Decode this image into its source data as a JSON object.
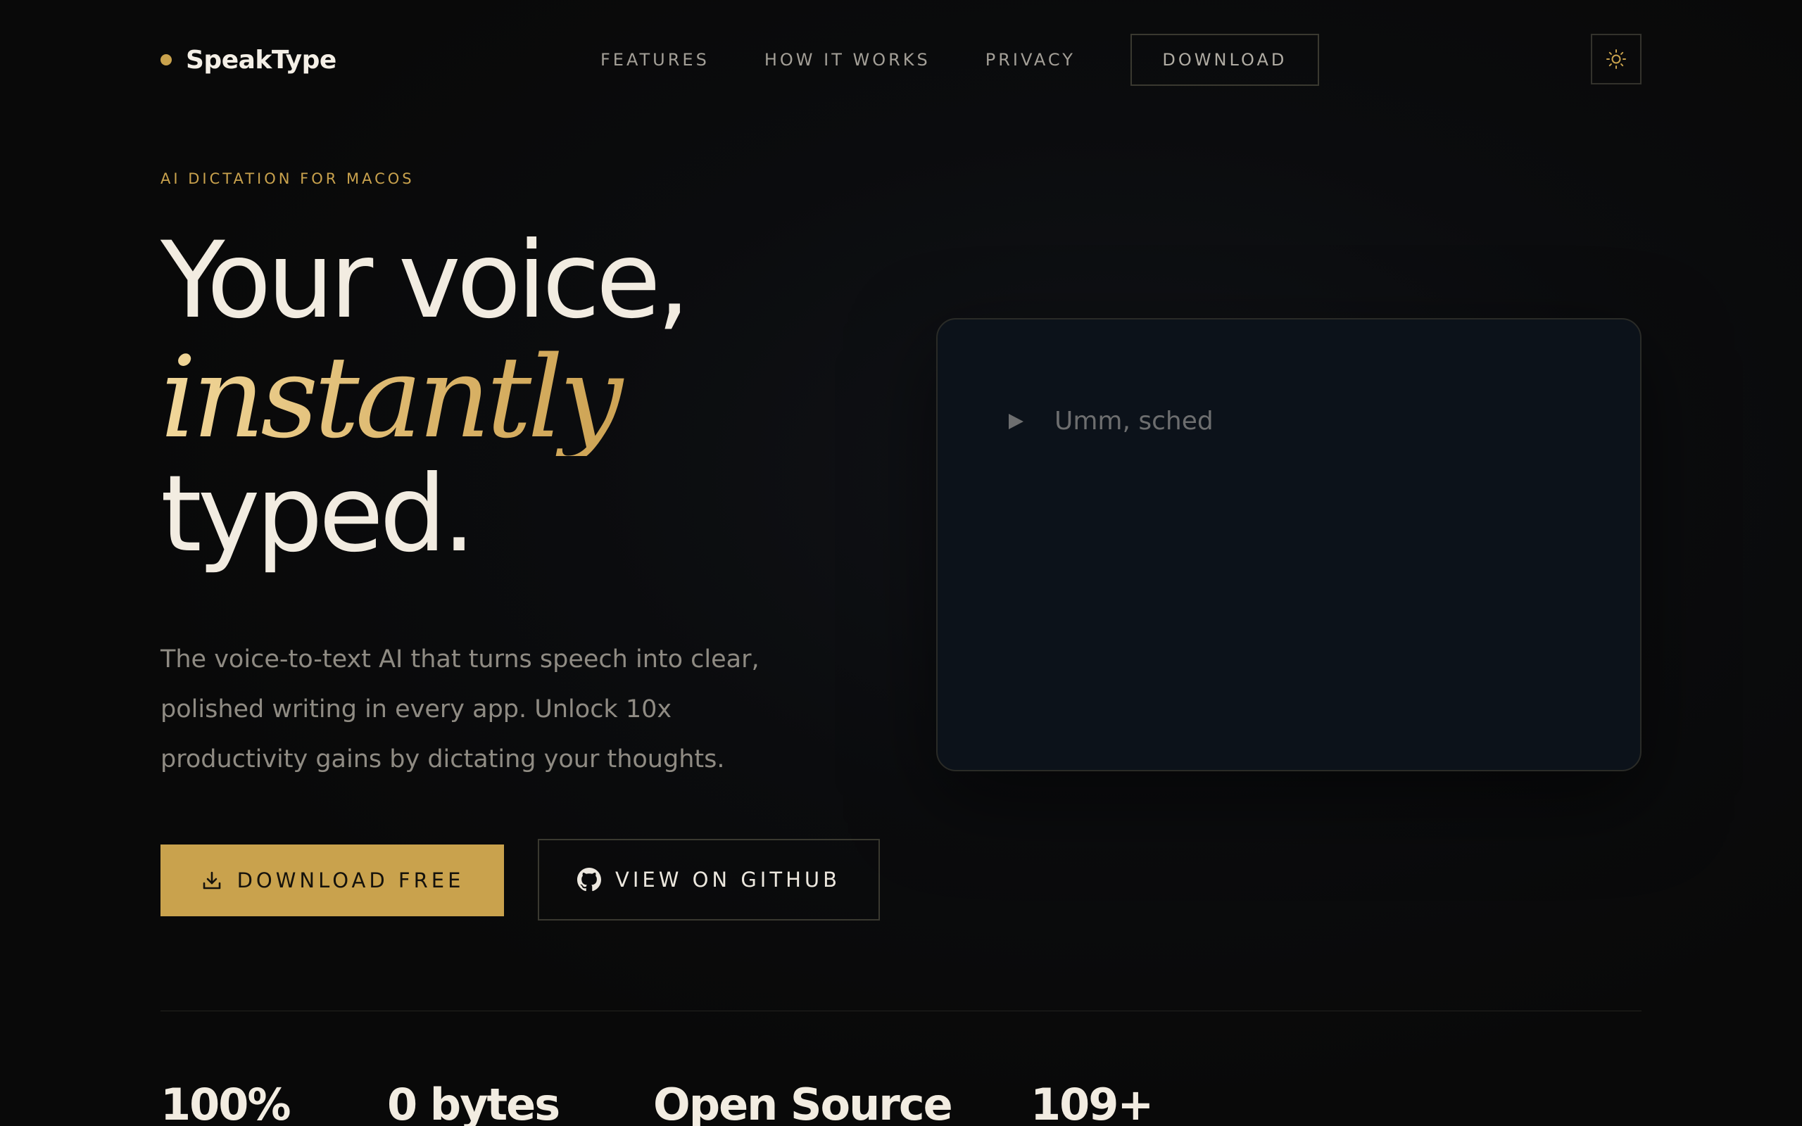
{
  "brand": {
    "name": "SpeakType"
  },
  "nav": {
    "links": [
      "FEATURES",
      "HOW IT WORKS",
      "PRIVACY"
    ],
    "download_label": "DOWNLOAD",
    "theme_icon": "sun-icon"
  },
  "hero": {
    "eyebrow": "AI DICTATION FOR MACOS",
    "headline": {
      "line1": "Your voice,",
      "line2": "instantly",
      "line3": "typed."
    },
    "subtitle": "The voice-to-text AI that turns speech into clear, polished writing in every app. Unlock 10x productivity gains by dictating your thoughts.",
    "primary_button": "DOWNLOAD FREE",
    "primary_icon": "download-icon",
    "secondary_button": "VIEW ON GITHUB",
    "secondary_icon": "github-icon"
  },
  "demo": {
    "icon": "play-icon",
    "typed_text": "Umm, sched"
  },
  "stats": [
    "100%",
    "0 bytes",
    "Open Source",
    "109+"
  ],
  "colors": {
    "accent": "#c9a24d",
    "background": "#0a0a0b",
    "panel": "#0c121a",
    "text": "#f2ece1",
    "muted": "#8f8b83"
  }
}
